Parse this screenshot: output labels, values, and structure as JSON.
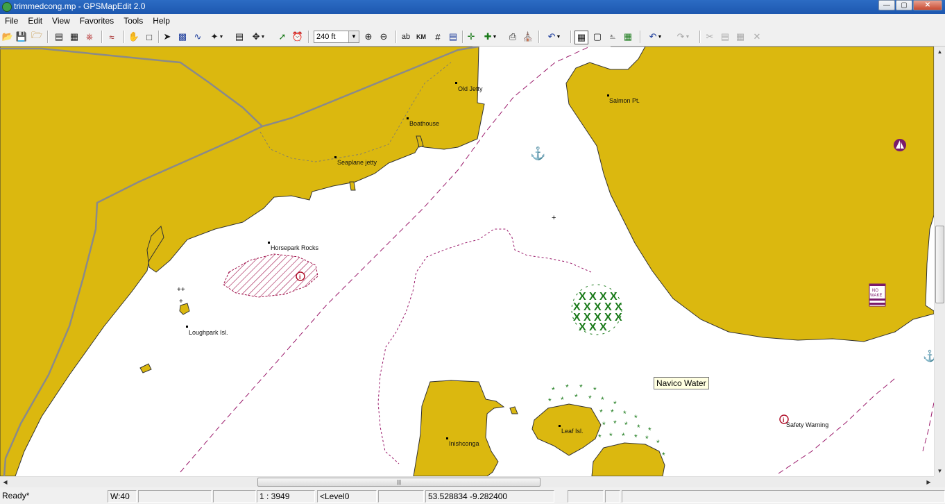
{
  "window": {
    "title": "trimmedcong.mp - GPSMapEdit 2.0",
    "controls": {
      "minimize": "—",
      "maximize": "▢",
      "close": "✕"
    }
  },
  "menu": [
    "File",
    "Edit",
    "View",
    "Favorites",
    "Tools",
    "Help"
  ],
  "toolbar": {
    "zoom_value": "240 ft",
    "text_buttons": {
      "labels": "ab",
      "scale": "KM"
    }
  },
  "map": {
    "labels": {
      "old_jetty": "Old Jetty",
      "boathouse": "Boathouse",
      "seaplane_jetty": "Seaplane jetty",
      "salmon_pt": "Salmon Pt.",
      "horsepark_rocks": "Horsepark Rocks",
      "loughpark_isl": "Loughpark Isl.",
      "inishconga": "Inishconga",
      "leaf_isl": "Leaf Isl.",
      "safety_warning": "Safety Warning"
    },
    "no_wake_sign": [
      "NO",
      "WAKE"
    ],
    "tooltip": "Navico Water",
    "colors": {
      "land": "#dbb80f",
      "water": "#ffffff",
      "restricted_hatch": "#a0104a",
      "depth_contour": "#9b1a6b",
      "vegetation": "#1a7a1a",
      "road": "#8a8a8a"
    }
  },
  "status": {
    "state": "Ready*",
    "width": "W:40",
    "scale": "1 : 3949",
    "level": "<Level0",
    "coords": "53.528834  -9.282400"
  }
}
